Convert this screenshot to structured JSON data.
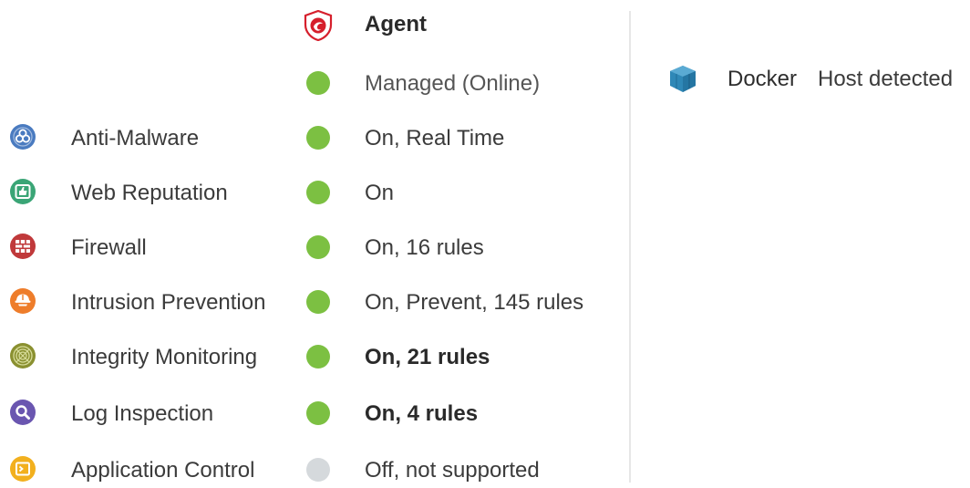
{
  "agent": {
    "title": "Agent",
    "status": "Managed (Online)",
    "status_state": "on"
  },
  "features": [
    {
      "name": "Anti-Malware",
      "icon": "biohazard-icon",
      "color": "#4a7bc0",
      "state": "on",
      "status": "On, Real Time",
      "bold": false
    },
    {
      "name": "Web Reputation",
      "icon": "web-reputation-icon",
      "color": "#3aa576",
      "state": "on",
      "status": "On",
      "bold": false
    },
    {
      "name": "Firewall",
      "icon": "firewall-icon",
      "color": "#c0393b",
      "state": "on",
      "status": "On, 16 rules",
      "bold": false
    },
    {
      "name": "Intrusion Prevention",
      "icon": "intrusion-prevention-icon",
      "color": "#ee7d2b",
      "state": "on",
      "status": "On, Prevent, 145 rules",
      "bold": false
    },
    {
      "name": "Integrity Monitoring",
      "icon": "integrity-monitoring-icon",
      "color": "#8a9030",
      "state": "on",
      "status": "On, 21 rules",
      "bold": true
    },
    {
      "name": "Log Inspection",
      "icon": "magnifier-icon",
      "color": "#6a56b0",
      "state": "on",
      "status": "On, 4 rules",
      "bold": true
    },
    {
      "name": "Application Control",
      "icon": "application-control-icon",
      "color": "#f2b01e",
      "state": "off",
      "status": "Off, not supported",
      "bold": false
    }
  ],
  "docker": {
    "name": "Docker",
    "status": "Host detected"
  },
  "colors": {
    "on": "#7cc042",
    "off": "#d5d9dc",
    "agent_red": "#d61f2c",
    "docker_blue": "#2f88b7"
  }
}
